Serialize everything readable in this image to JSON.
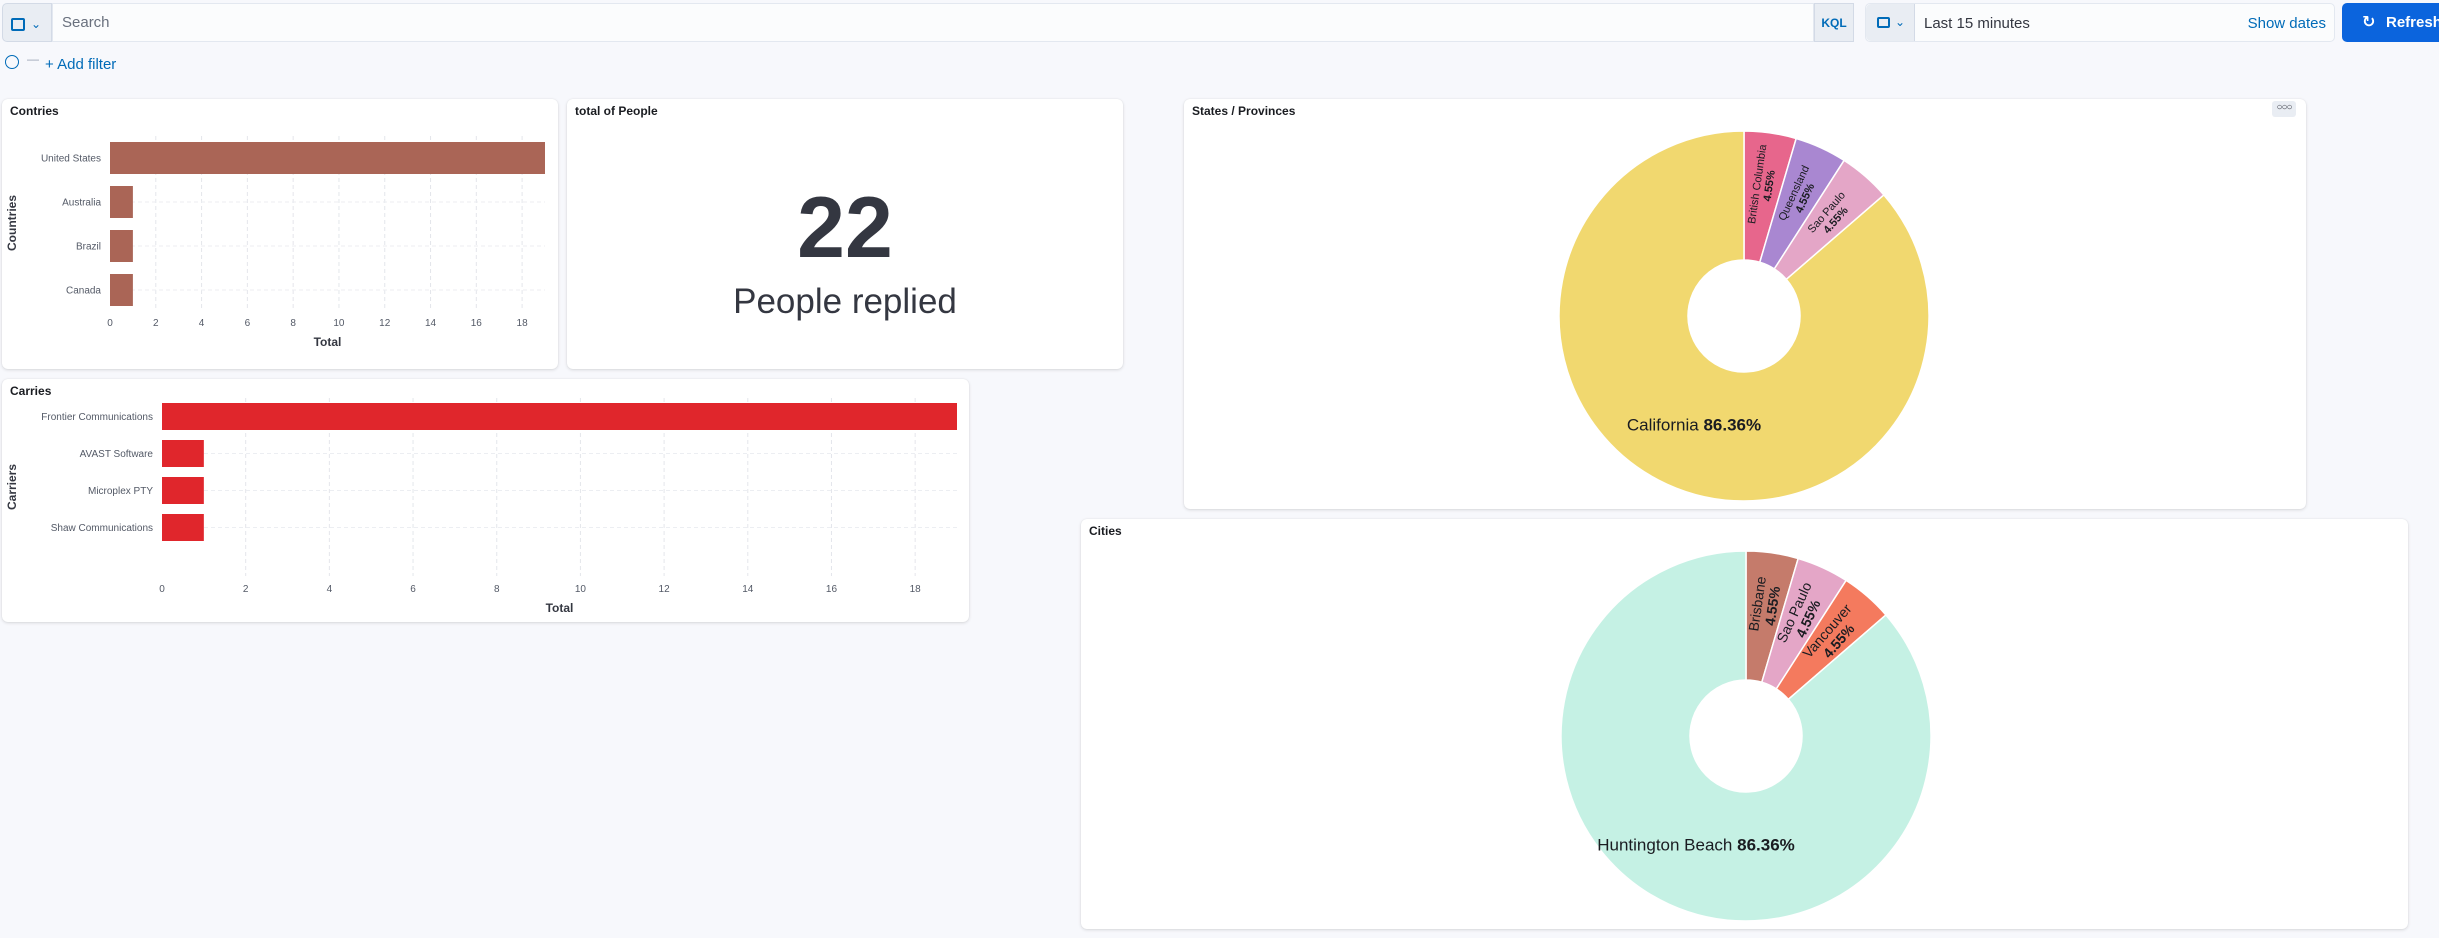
{
  "query_bar": {
    "search_placeholder": "Search",
    "language_label": "KQL",
    "date_range": "Last 15 minutes",
    "show_dates_label": "Show dates",
    "refresh_label": "Refresh"
  },
  "filters": {
    "add_filter_label": "+ Add filter"
  },
  "panels": {
    "countries": {
      "title": "Contries"
    },
    "total_people": {
      "title": "total of People",
      "value": "22",
      "label": "People replied"
    },
    "states": {
      "title": "States / Provinces"
    },
    "carriers": {
      "title": "Carries"
    },
    "cities": {
      "title": "Cities"
    }
  },
  "chart_data": [
    {
      "type": "bar",
      "orientation": "horizontal",
      "title": "Contries",
      "categories": [
        "United States",
        "Australia",
        "Brazil",
        "Canada"
      ],
      "values": [
        19,
        1,
        1,
        1
      ],
      "xlabel": "Total",
      "ylabel": "Countries",
      "xlim": [
        0,
        19
      ],
      "xticks": [
        0,
        2,
        4,
        6,
        8,
        10,
        12,
        14,
        16,
        18
      ],
      "color": "#aa6556",
      "grid": true
    },
    {
      "type": "pie",
      "donut": true,
      "title": "States / Provinces",
      "slices": [
        {
          "label": "British Columbia",
          "value": 4.55,
          "pct": "4.55%",
          "color": "#e7668c"
        },
        {
          "label": "Queensland",
          "value": 4.55,
          "pct": "4.55%",
          "color": "#a987d1"
        },
        {
          "label": "Sao Paulo",
          "value": 4.55,
          "pct": "4.55%",
          "color": "#e4a6c7"
        },
        {
          "label": "California",
          "value": 86.36,
          "pct": "86.36%",
          "color": "#f1d86f"
        }
      ]
    },
    {
      "type": "bar",
      "orientation": "horizontal",
      "title": "Carries",
      "categories": [
        "Frontier Communications",
        "AVAST Software",
        "Microplex PTY",
        "Shaw Communications"
      ],
      "values": [
        19,
        1,
        1,
        1
      ],
      "xlabel": "Total",
      "ylabel": "Carriers",
      "xlim": [
        0,
        19
      ],
      "xticks": [
        0,
        2,
        4,
        6,
        8,
        10,
        12,
        14,
        16,
        18
      ],
      "color": "#e0262c",
      "grid": true
    },
    {
      "type": "pie",
      "donut": true,
      "title": "Cities",
      "slices": [
        {
          "label": "Brisbane",
          "value": 4.55,
          "pct": "4.55%",
          "color": "#c57b6b"
        },
        {
          "label": "Sao Paulo",
          "value": 4.55,
          "pct": "4.55%",
          "color": "#e4a6c7"
        },
        {
          "label": "Vancouver",
          "value": 4.55,
          "pct": "4.55%",
          "color": "#f47a5e"
        },
        {
          "label": "Huntington Beach",
          "value": 86.36,
          "pct": "86.36%",
          "color": "#c5f1e4"
        }
      ]
    }
  ],
  "colors": {
    "accent": "#006bb8",
    "refresh_button": "#0b64dd"
  },
  "icons": {
    "query_menu": "saved-query-icon",
    "calendar": "calendar-icon",
    "refresh": "refresh-icon",
    "filter": "filter-icon",
    "panel_menu": "ellipsis-icon"
  }
}
